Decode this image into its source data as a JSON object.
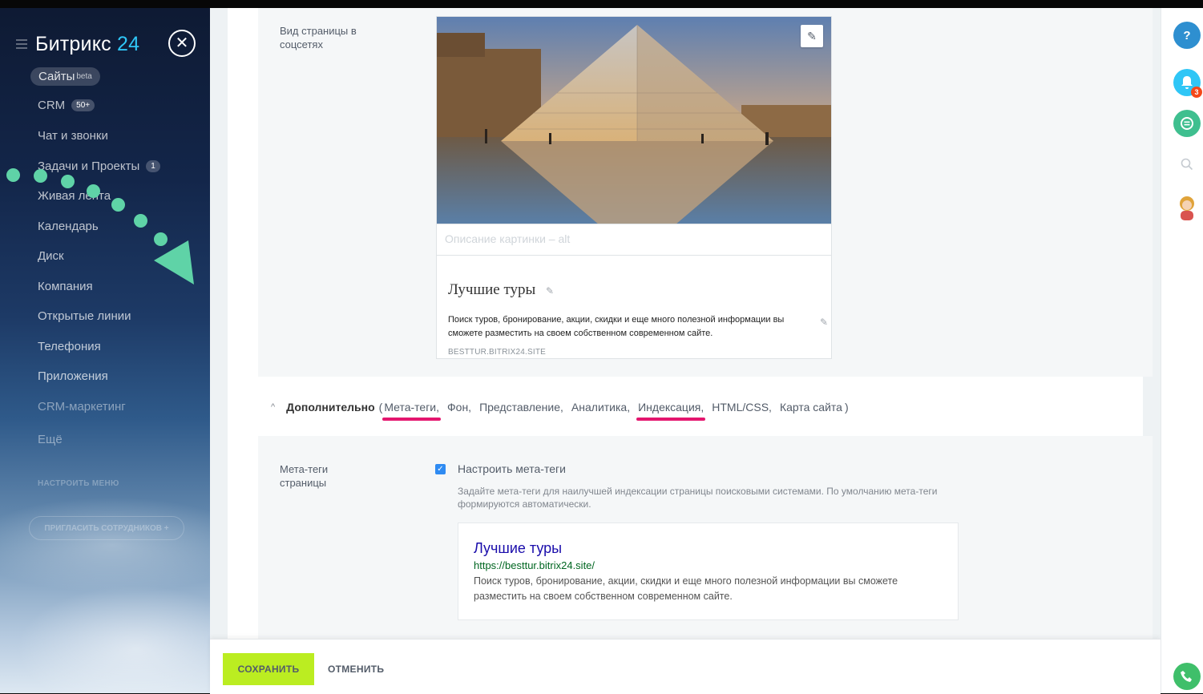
{
  "sidebar": {
    "logo_main": "Битрикс",
    "logo_num": "24",
    "close_glyph": "✕",
    "items": [
      {
        "label": "Сайты",
        "sup": "beta"
      },
      {
        "label": "CRM",
        "counter": "50+"
      },
      {
        "label": "Чат и звонки"
      },
      {
        "label": "Задачи и Проекты",
        "counter": "1"
      },
      {
        "label": "Живая лента"
      },
      {
        "label": "Календарь"
      },
      {
        "label": "Диск"
      },
      {
        "label": "Компания"
      },
      {
        "label": "Открытые линии"
      },
      {
        "label": "Телефония"
      },
      {
        "label": "Приложения"
      },
      {
        "label": "CRM-маркетинг"
      },
      {
        "label": "Ещё"
      }
    ],
    "configure_menu": "НАСТРОИТЬ МЕНЮ",
    "invite_label": "ПРИГЛАСИТЬ СОТРУДНИКОВ  +"
  },
  "social": {
    "label": "Вид страницы в соцсетях",
    "alt_placeholder": "Описание картинки – alt",
    "card_title": "Лучшие туры",
    "card_description": "Поиск туров, бронирование, акции, скидки и еще много полезной информации вы сможете разместить на своем собственном современном сайте.",
    "card_url": "BESTTUR.BITRIX24.SITE",
    "edit_glyph": "✎"
  },
  "advanced": {
    "chevron": "^",
    "title": "Дополнительно",
    "open_paren": "(",
    "close_paren": ")",
    "links": [
      {
        "label": "Мета-теги,",
        "highlight": true
      },
      {
        "label": "Фон,",
        "highlight": false
      },
      {
        "label": "Представление,",
        "highlight": false
      },
      {
        "label": "Аналитика,",
        "highlight": false
      },
      {
        "label": "Индексация,",
        "highlight": true
      },
      {
        "label": "HTML/CSS,",
        "highlight": false
      },
      {
        "label": "Карта сайта",
        "highlight": false
      }
    ],
    "underline_color": "#e4166e"
  },
  "meta": {
    "label": "Мета-теги страницы",
    "checkbox_label": "Настроить мета-теги",
    "checked": true,
    "hint": "Задайте мета-теги для наилучшей индексации страницы поисковыми системами. По умолчанию мета-теги формируются автоматически.",
    "serp_title": "Лучшие туры",
    "serp_url": "https://besttur.bitrix24.site/",
    "serp_description": "Поиск туров, бронирование, акции, скидки и еще много полезной информации вы сможете разместить на своем собственном современном сайте."
  },
  "footer": {
    "save_label": "СОХРАНИТЬ",
    "cancel_label": "ОТМЕНИТЬ"
  },
  "right_panel": {
    "help_glyph": "?",
    "notification_count": "3"
  },
  "colors": {
    "save_button": "#bbed21",
    "accent": "#2fc6f6",
    "overlay_dots": "#5fd3a7",
    "serp_title": "#1a0dab",
    "serp_url": "#006621"
  }
}
